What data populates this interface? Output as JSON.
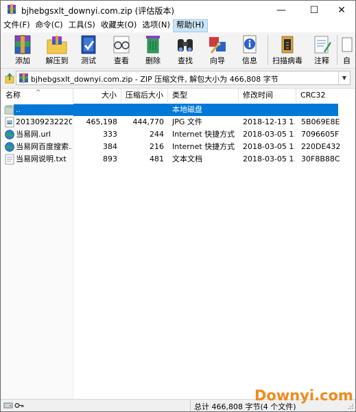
{
  "window": {
    "title": "bjhebgsxlt_downyi.com.zip (评估版本)"
  },
  "title_controls": {
    "minimize": "—",
    "maximize": "☐",
    "close": "✕"
  },
  "menu": [
    {
      "label": "文件(F)"
    },
    {
      "label": "命令(C)"
    },
    {
      "label": "工具(S)"
    },
    {
      "label": "收藏夹(O)"
    },
    {
      "label": "选项(N)"
    },
    {
      "label": "帮助(H)",
      "active": true
    }
  ],
  "toolbar": {
    "add": "添加",
    "extract": "解压到",
    "test": "测试",
    "view": "查看",
    "delete": "删除",
    "find": "查找",
    "wizard": "向导",
    "info": "信息",
    "scan": "扫描病毒",
    "comment": "注释",
    "more": "自"
  },
  "address": {
    "path": "bjhebgsxlt_downyi.com.zip - ZIP 压缩文件, 解包大小为 466,808 字节"
  },
  "columns": {
    "name": "名称",
    "size": "大小",
    "packed": "压缩后大小",
    "type": "类型",
    "modified": "修改时间",
    "crc": "CRC32"
  },
  "files": [
    {
      "name": "..",
      "size": "",
      "packed": "",
      "type": "本地磁盘",
      "modified": "",
      "crc": "",
      "icon": "folder-up-icon",
      "selected": true
    },
    {
      "name": "201309232220...",
      "size": "465,198",
      "packed": "444,770",
      "type": "JPG 文件",
      "modified": "2018-12-13 1...",
      "crc": "5B069E8E",
      "icon": "image-file-icon"
    },
    {
      "name": "当易网.url",
      "size": "333",
      "packed": "244",
      "type": "Internet 快捷方式",
      "modified": "2018-03-05 1...",
      "crc": "7096605F",
      "icon": "internet-shortcut-icon"
    },
    {
      "name": "当易网百度搜索...",
      "size": "384",
      "packed": "216",
      "type": "Internet 快捷方式",
      "modified": "2018-03-05 1...",
      "crc": "220DE432",
      "icon": "internet-shortcut-icon"
    },
    {
      "name": "当易网说明.txt",
      "size": "893",
      "packed": "481",
      "type": "文本文档",
      "modified": "2018-03-05 1...",
      "crc": "30F8B88C",
      "icon": "text-file-icon"
    }
  ],
  "status": {
    "summary": "总计 466,808 字节(4 个文件)"
  },
  "watermark": "Downyi.com",
  "colors": {
    "selection": "#0078d7",
    "menu_active": "#cce4f7",
    "watermark": "#f08a1c"
  }
}
